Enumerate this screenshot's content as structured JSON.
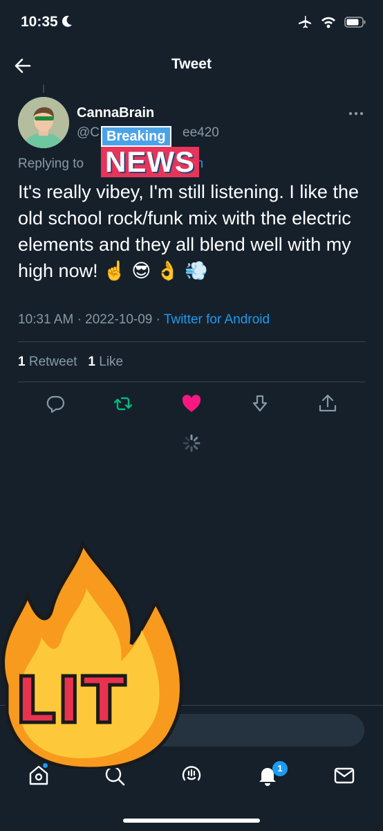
{
  "status_bar": {
    "time": "10:35",
    "icons": [
      "moon-icon",
      "airplane-icon",
      "wifi-icon",
      "battery-icon"
    ]
  },
  "header": {
    "title": "Tweet",
    "back_icon": "back-arrow-icon"
  },
  "tweet": {
    "display_name": "CannaBrain",
    "handle_prefix": "@C",
    "handle_suffix": "ee420",
    "replying_to_label": "Replying to",
    "replying_to_suffix": "yn",
    "text": "It's really vibey, I'm still listening. I like the old school rock/funk mix with the electric elements and they all blend well with my high now!",
    "emojis": [
      "☝️",
      "😎",
      "👌",
      "💨"
    ],
    "time": "10:31 AM",
    "separator": "·",
    "date": "2022-10-09",
    "source": "Twitter for Android",
    "retweet_count": "1",
    "retweet_label": "Retweet",
    "like_count": "1",
    "like_label": "Like"
  },
  "actions": {
    "reply": "reply-icon",
    "retweet": "retweet-icon",
    "like": "heart-icon",
    "download": "download-icon",
    "share": "share-icon",
    "retweeted": true,
    "liked": true
  },
  "reply_box": {
    "placeholder_visible": "y"
  },
  "tabbar": {
    "items": [
      "home-icon",
      "search-icon",
      "spaces-icon",
      "notifications-icon",
      "messages-icon"
    ],
    "notification_badge": "1"
  },
  "stickers": {
    "news_top": "Breaking",
    "news_bottom": "NEWS",
    "lit": "LIT"
  },
  "colors": {
    "background": "#15202b",
    "accent": "#1d9bf0",
    "like": "#f91880",
    "retweet": "#00ba7c",
    "secondary_text": "#8899a6"
  }
}
